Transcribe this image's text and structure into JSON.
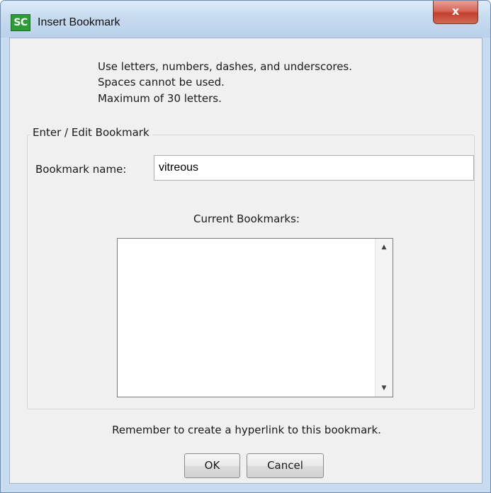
{
  "window": {
    "title": "Insert Bookmark",
    "app_icon_text": "SC",
    "close_glyph": "x",
    "icons": {
      "app": "app-logo-icon",
      "close": "close-icon",
      "scroll_up": "scroll-up-arrow-icon",
      "scroll_down": "scroll-down-arrow-icon"
    }
  },
  "instructions": {
    "line1": "Use letters, numbers, dashes, and underscores.",
    "line2": "Spaces cannot be used.",
    "line3": "Maximum of 30 letters."
  },
  "group": {
    "legend": "Enter / Edit Bookmark",
    "name_label": "Bookmark name:",
    "name_value": "vitreous",
    "current_label": "Current Bookmarks:",
    "bookmarks": []
  },
  "footer": {
    "reminder": "Remember to create a hyperlink to this bookmark.",
    "ok_label": "OK",
    "cancel_label": "Cancel"
  },
  "colors": {
    "frame": "#c9dbee",
    "client_bg": "#f0f0f0",
    "close_button": "#c2402f",
    "app_icon": "#2f9a3a"
  }
}
